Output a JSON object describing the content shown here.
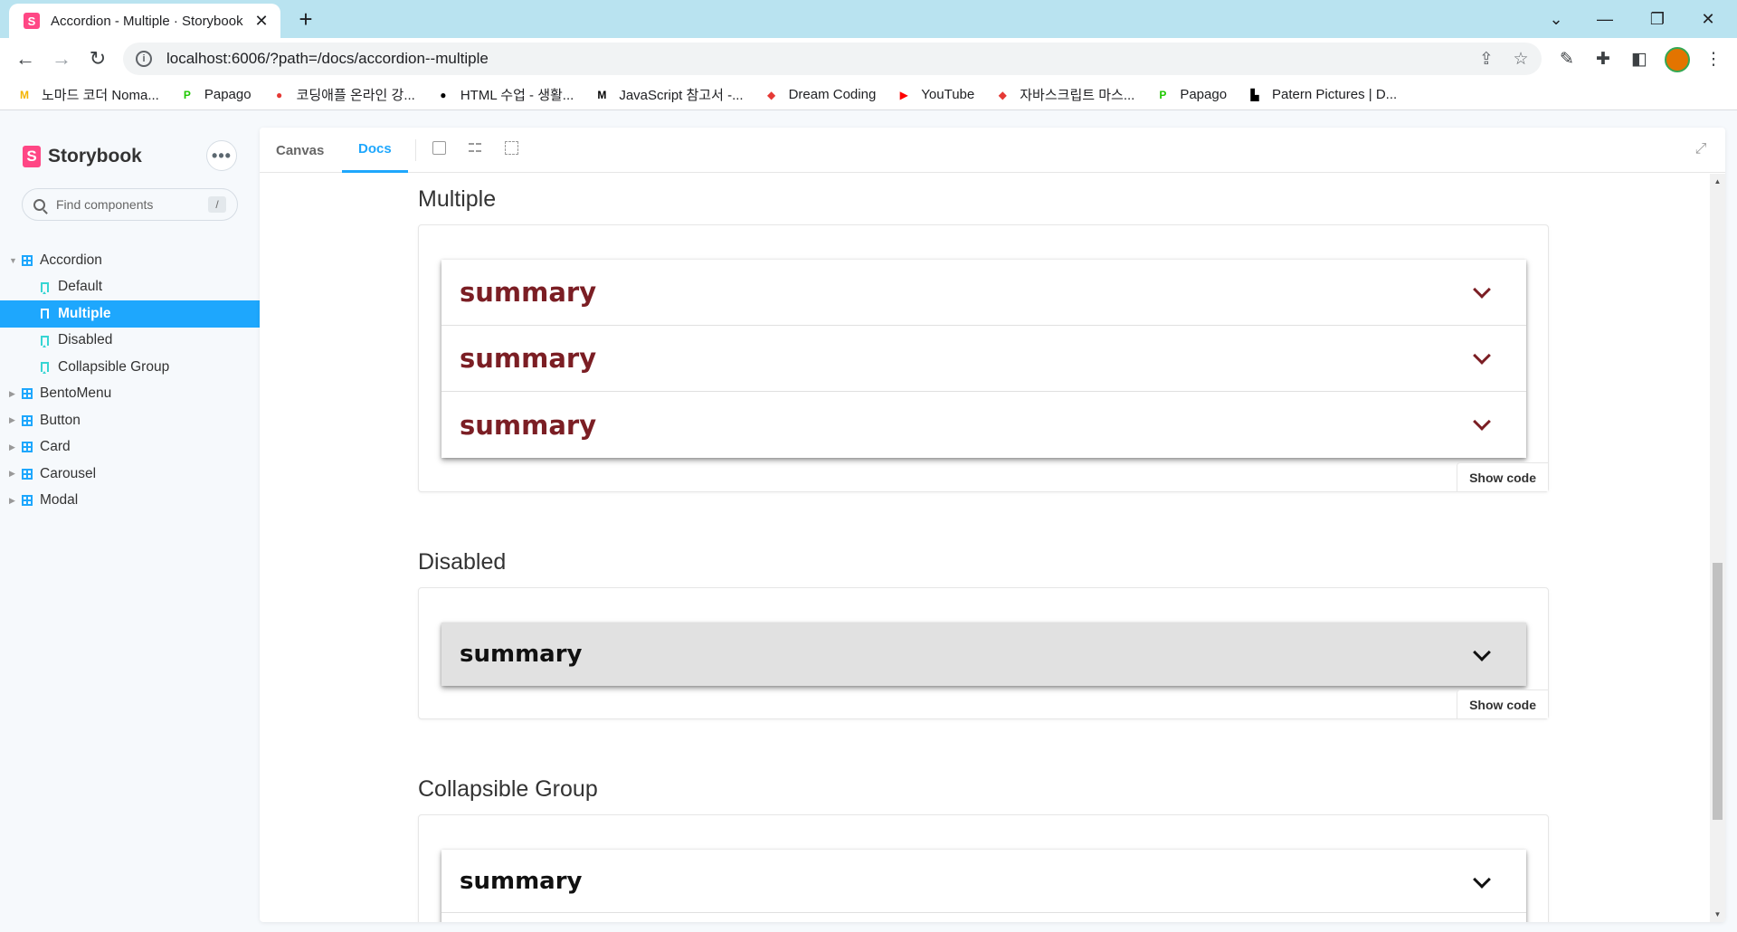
{
  "browser": {
    "tab_title": "Accordion - Multiple · Storybook",
    "tab_favicon": "S",
    "new_tab": "+",
    "url": "localhost:6006/?path=/docs/accordion--multiple"
  },
  "bookmarks": [
    {
      "label": "노마드 코더 Noma...",
      "icon": "nomad-icon",
      "color": "#f4b400",
      "glyph": "M"
    },
    {
      "label": "Papago",
      "icon": "papago-icon",
      "color": "#1ec800",
      "glyph": "P"
    },
    {
      "label": "코딩애플 온라인 강...",
      "icon": "apple-icon",
      "color": "#e53935",
      "glyph": "●"
    },
    {
      "label": "HTML 수업 - 생활...",
      "icon": "circle-icon",
      "color": "#000000",
      "glyph": "●"
    },
    {
      "label": "JavaScript 참고서 -...",
      "icon": "mdn-icon",
      "color": "#000000",
      "glyph": "M"
    },
    {
      "label": "Dream Coding",
      "icon": "dream-coding-icon",
      "color": "#e53935",
      "glyph": "◆"
    },
    {
      "label": "YouTube",
      "icon": "youtube-icon",
      "color": "#ff0000",
      "glyph": "▶"
    },
    {
      "label": "자바스크립트 마스...",
      "icon": "diamond-icon",
      "color": "#e53935",
      "glyph": "◆"
    },
    {
      "label": "Papago",
      "icon": "papago-icon",
      "color": "#1ec800",
      "glyph": "P"
    },
    {
      "label": "Patern Pictures | D...",
      "icon": "unsplash-icon",
      "color": "#000000",
      "glyph": "▙"
    }
  ],
  "sidebar": {
    "brand": "Storybook",
    "logo": "S",
    "search_placeholder": "Find components",
    "search_shortcut": "/",
    "tree": [
      {
        "label": "Accordion",
        "kind": "component",
        "expanded": true
      },
      {
        "label": "Default",
        "kind": "story"
      },
      {
        "label": "Multiple",
        "kind": "story",
        "active": true
      },
      {
        "label": "Disabled",
        "kind": "story"
      },
      {
        "label": "Collapsible Group",
        "kind": "story"
      },
      {
        "label": "BentoMenu",
        "kind": "component"
      },
      {
        "label": "Button",
        "kind": "component"
      },
      {
        "label": "Card",
        "kind": "component"
      },
      {
        "label": "Carousel",
        "kind": "component"
      },
      {
        "label": "Modal",
        "kind": "component"
      }
    ]
  },
  "toolbar": {
    "tabs": [
      "Canvas",
      "Docs"
    ],
    "active_tab": "Docs"
  },
  "docs": {
    "sections": [
      {
        "title": "Multiple",
        "items": [
          "summary",
          "summary",
          "summary"
        ],
        "show_code": "Show code"
      },
      {
        "title": "Disabled",
        "items": [
          "summary"
        ],
        "show_code": "Show code"
      },
      {
        "title": "Collapsible Group",
        "items": [
          "summary"
        ]
      }
    ]
  },
  "colors": {
    "accent": "#1ea7fd",
    "summary_active": "#7b1e24",
    "storybook_pink": "#ff4785"
  }
}
